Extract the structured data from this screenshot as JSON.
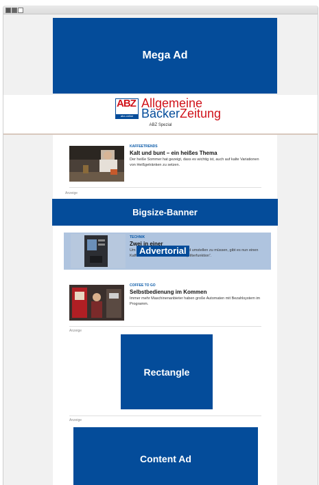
{
  "colors": {
    "brand_blue": "#044c9a",
    "brand_red": "#d0121a",
    "advertorial_tint": "#afc4df"
  },
  "window": {
    "controls": [
      "close-icon",
      "minimize-icon",
      "maximize-icon"
    ]
  },
  "ads": {
    "mega": "Mega Ad",
    "bigsize": "Bigsize-Banner",
    "advertorial": "Advertorial",
    "rectangle": "Rectangle",
    "content": "Content Ad"
  },
  "header": {
    "logo_letters": "ABZ",
    "logo_strip": "abz-online",
    "brand_line1": "Allgemeine",
    "brand_line2a": "Bäcker",
    "brand_line2b": "Zeitung",
    "subtitle": "ABZ Spezial"
  },
  "anzeige_label": "Anzeige",
  "articles": [
    {
      "category": "KAFFEETRENDS",
      "title": "Kalt und bunt – ein heißes Thema",
      "desc": "Der heiße Sommer hat gezeigt, dass es wichtig ist, auch auf kalte Variationen von Heißgetränken zu setzen."
    },
    {
      "category": "TECHNIK",
      "title": "Zwei in einer",
      "desc": "Um nicht ständig Filter tauschen und umstellen zu müssen, gibt es nun einen Kaffeeautomaten mit zusätzlicher „Filterfunktion“."
    },
    {
      "category": "COFFEE TO GO",
      "title": "Selbstbedienung im Kommen",
      "desc": "Immer mehr Maschinenanbieter haben große Automaten mit Bezahlsystem im Programm."
    }
  ]
}
